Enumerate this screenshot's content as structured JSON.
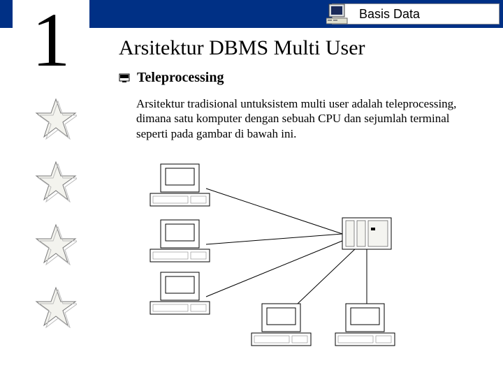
{
  "header": {
    "course_title": "Basis Data",
    "page_number": "1"
  },
  "content": {
    "slide_title": "Arsitektur DBMS Multi User",
    "bullet_heading": "Teleprocessing",
    "body": "Arsitektur tradisional untuksistem multi user adalah teleprocessing, dimana satu komputer dengan sebuah CPU dan sejumlah terminal seperti pada gambar di bawah ini."
  },
  "icons": {
    "header_icon": "computer-icon",
    "bullet_icon": "screen-bullet-icon",
    "star_icon": "star-decoration"
  },
  "diagram": {
    "type": "network-topology",
    "description": "Five terminal computers connected by lines to one central server",
    "nodes": {
      "terminals": 5,
      "servers": 1
    }
  }
}
